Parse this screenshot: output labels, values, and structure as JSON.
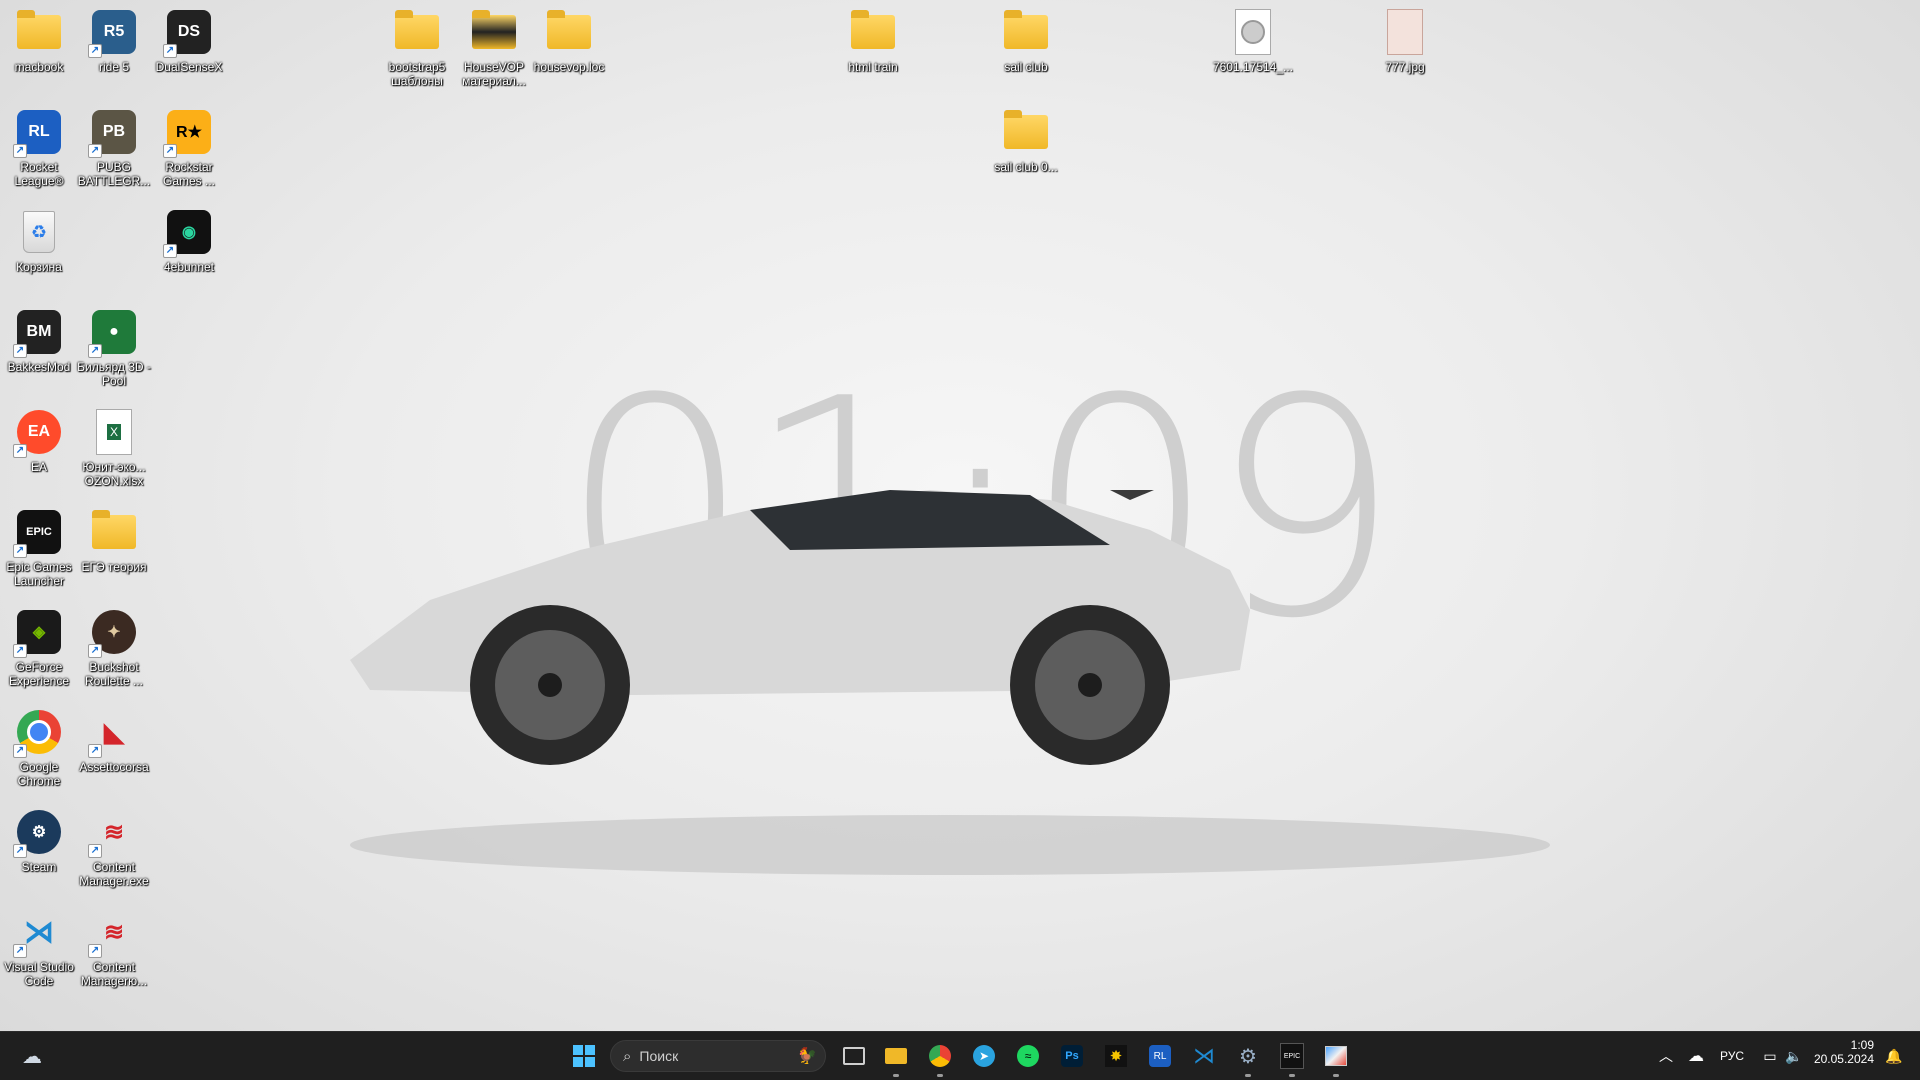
{
  "wallpaper": {
    "clock": "01:09"
  },
  "desktop_icons": [
    {
      "label": "macbook",
      "type": "folder"
    },
    {
      "label": "ride 5",
      "type": "app"
    },
    {
      "label": "DualSenseX",
      "type": "app"
    },
    {
      "label": "bootstrap5 шаблоны",
      "type": "folder"
    },
    {
      "label": "HouseVOP материал...",
      "type": "folder"
    },
    {
      "label": "housevop.loc",
      "type": "folder"
    },
    {
      "label": "html train",
      "type": "folder"
    },
    {
      "label": "sail club",
      "type": "folder"
    },
    {
      "label": "7601.17514_...",
      "type": "file"
    },
    {
      "label": "777.jpg",
      "type": "image"
    },
    {
      "label": "Rocket League®",
      "type": "app"
    },
    {
      "label": "PUBG BATTLEGR...",
      "type": "app"
    },
    {
      "label": "Rockstar Games ...",
      "type": "app"
    },
    {
      "label": "sail club 0...",
      "type": "folder"
    },
    {
      "label": "Корзина",
      "type": "recycle"
    },
    {
      "label": "4ebunnet",
      "type": "app"
    },
    {
      "label": "BakkesMod",
      "type": "app"
    },
    {
      "label": "Бильярд 3D - Pool",
      "type": "app"
    },
    {
      "label": "EA",
      "type": "app"
    },
    {
      "label": "Юнит-эко... OZON.xlsx",
      "type": "excel"
    },
    {
      "label": "Epic Games Launcher",
      "type": "app"
    },
    {
      "label": "ЕГЭ теория",
      "type": "folder"
    },
    {
      "label": "GeForce Experience",
      "type": "app"
    },
    {
      "label": "Buckshot Roulette ...",
      "type": "app"
    },
    {
      "label": "Google Chrome",
      "type": "app"
    },
    {
      "label": "Assettocorsa",
      "type": "app"
    },
    {
      "label": "Steam",
      "type": "app"
    },
    {
      "label": "Content Manager.exe",
      "type": "app"
    },
    {
      "label": "Visual Studio Code",
      "type": "app"
    },
    {
      "label": "Content Managerю...",
      "type": "app"
    }
  ],
  "taskbar": {
    "search_placeholder": "Поиск",
    "pinned": [
      "windows-start",
      "search",
      "task-view",
      "file-explorer",
      "google-chrome",
      "telegram",
      "spotify",
      "photoshop",
      "launcher",
      "rocket-league",
      "vscode",
      "settings",
      "epic-games",
      "control-panel"
    ],
    "language": "РУС",
    "time": "1:09",
    "date": "20.05.2024"
  }
}
